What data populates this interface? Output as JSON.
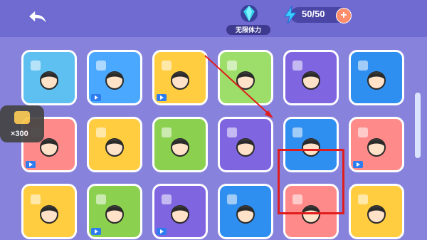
{
  "header": {
    "badge_label": "无限体力",
    "energy": "50/50",
    "plus": "+"
  },
  "side": {
    "count": "×300"
  },
  "tiles": [
    {
      "row": 0,
      "col": 0,
      "color": "#5ec0f0",
      "video": false
    },
    {
      "row": 0,
      "col": 1,
      "color": "#4aa8ff",
      "video": true
    },
    {
      "row": 0,
      "col": 2,
      "color": "#ffcd3f",
      "video": true
    },
    {
      "row": 0,
      "col": 3,
      "color": "#9dde6a",
      "video": false
    },
    {
      "row": 0,
      "col": 4,
      "color": "#7f65e0",
      "video": false
    },
    {
      "row": 0,
      "col": 5,
      "color": "#2f8ff0",
      "video": false
    },
    {
      "row": 1,
      "col": 0,
      "color": "#ff8a8a",
      "video": true
    },
    {
      "row": 1,
      "col": 1,
      "color": "#ffcd3f",
      "video": false
    },
    {
      "row": 1,
      "col": 2,
      "color": "#8bd14f",
      "video": false
    },
    {
      "row": 1,
      "col": 3,
      "color": "#7f65e0",
      "video": false
    },
    {
      "row": 1,
      "col": 4,
      "color": "#2f8ff0",
      "video": false
    },
    {
      "row": 1,
      "col": 5,
      "color": "#ff8a8a",
      "video": true
    },
    {
      "row": 2,
      "col": 0,
      "color": "#ffcd3f",
      "video": false
    },
    {
      "row": 2,
      "col": 1,
      "color": "#8bd14f",
      "video": true
    },
    {
      "row": 2,
      "col": 2,
      "color": "#7f65e0",
      "video": true
    },
    {
      "row": 2,
      "col": 3,
      "color": "#2f8ff0",
      "video": false
    },
    {
      "row": 2,
      "col": 4,
      "color": "#ff8a8a",
      "video": false
    },
    {
      "row": 2,
      "col": 5,
      "color": "#ffcd3f",
      "video": false
    }
  ]
}
